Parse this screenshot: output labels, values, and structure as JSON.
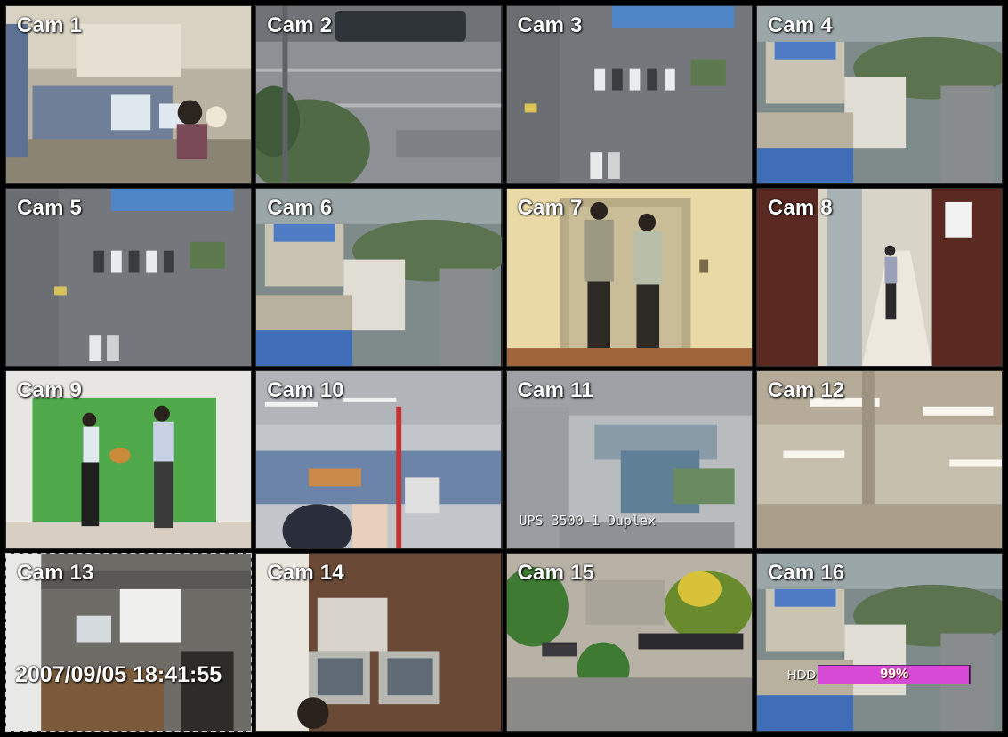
{
  "cameras": [
    {
      "label": "Cam 1",
      "scene": "office"
    },
    {
      "label": "Cam 2",
      "scene": "street"
    },
    {
      "label": "Cam 3",
      "scene": "parking"
    },
    {
      "label": "Cam 4",
      "scene": "rooftops"
    },
    {
      "label": "Cam 5",
      "scene": "parking"
    },
    {
      "label": "Cam 6",
      "scene": "rooftops"
    },
    {
      "label": "Cam 7",
      "scene": "elevator"
    },
    {
      "label": "Cam 8",
      "scene": "corridor"
    },
    {
      "label": "Cam 9",
      "scene": "green-wall"
    },
    {
      "label": "Cam 10",
      "scene": "office-2"
    },
    {
      "label": "Cam 11",
      "scene": "lab"
    },
    {
      "label": "Cam 12",
      "scene": "ceiling"
    },
    {
      "label": "Cam 13",
      "scene": "meeting-room"
    },
    {
      "label": "Cam 14",
      "scene": "monitor-room"
    },
    {
      "label": "Cam 15",
      "scene": "courtyard"
    },
    {
      "label": "Cam 16",
      "scene": "rooftops"
    }
  ],
  "selected_camera": "Cam 13",
  "timestamp": "2007/09/05 18:41:55",
  "cam11_overlay": "UPS 3500-1 Duplex",
  "hdd": {
    "label": "HDD",
    "percent_text": "99%",
    "usage": 0.99,
    "color": "#d64ad6"
  }
}
